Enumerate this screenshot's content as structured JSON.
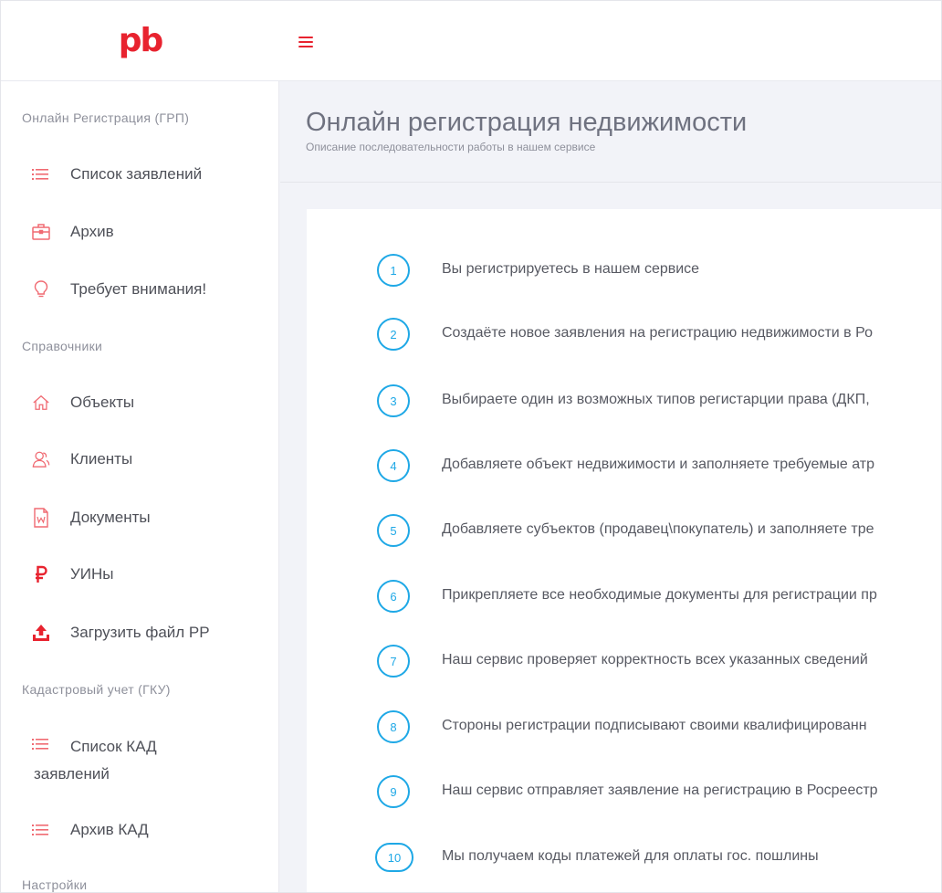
{
  "header": {
    "logo_text": "pb",
    "brand_color": "#e8232f",
    "menu_icon": "hamburger-menu-icon"
  },
  "sidebar": {
    "sections": [
      {
        "title": "Онлайн Регистрация (ГРП)",
        "items": [
          {
            "label": "Список заявлений",
            "icon": "list-icon"
          },
          {
            "label": "Архив",
            "icon": "archive-box-icon"
          },
          {
            "label": "Требует внимания!",
            "icon": "lightbulb-icon"
          }
        ]
      },
      {
        "title": "Справочники",
        "items": [
          {
            "label": "Объекты",
            "icon": "home-icon"
          },
          {
            "label": "Клиенты",
            "icon": "users-icon"
          },
          {
            "label": "Документы",
            "icon": "word-document-icon"
          },
          {
            "label": "УИНы",
            "icon": "ruble-icon"
          },
          {
            "label": "Загрузить файл РР",
            "icon": "upload-icon"
          }
        ]
      },
      {
        "title": "Кадастровый учет (ГКУ)",
        "items": [
          {
            "label": "Список КАД заявлений",
            "icon": "list-icon"
          },
          {
            "label": "Архив КАД",
            "icon": "list-icon"
          }
        ]
      },
      {
        "title": "Настройки",
        "items": []
      }
    ]
  },
  "main": {
    "title": "Онлайн регистрация недвижимости",
    "subtitle": "Описание последовательности работы в нашем сервисе",
    "accent_color": "#1ea8e6",
    "steps": [
      {
        "num": "1",
        "text": "Вы регистрируетесь в нашем сервисе"
      },
      {
        "num": "2",
        "text": "Создаёте новое заявления на регистрацию недвижимости в Ро"
      },
      {
        "num": "3",
        "text": "Выбираете один из возможных типов регистарции права (ДКП,"
      },
      {
        "num": "4",
        "text": "Добавляете объект недвижимости и заполняете требуемые атр"
      },
      {
        "num": "5",
        "text": "Добавляете субъектов (продавец\\покупатель) и заполняете тре"
      },
      {
        "num": "6",
        "text": "Прикрепляете все необходимые документы для регистрации пр"
      },
      {
        "num": "7",
        "text": "Наш сервис проверяет корректность всех указанных сведений"
      },
      {
        "num": "8",
        "text": "Стороны регистрации подписывают своими квалифицированн"
      },
      {
        "num": "9",
        "text": "Наш сервис отправляет заявление на регистрацию в Росреестр"
      },
      {
        "num": "10",
        "text": "Мы получаем коды платежей для оплаты гос. пошлины"
      }
    ]
  }
}
